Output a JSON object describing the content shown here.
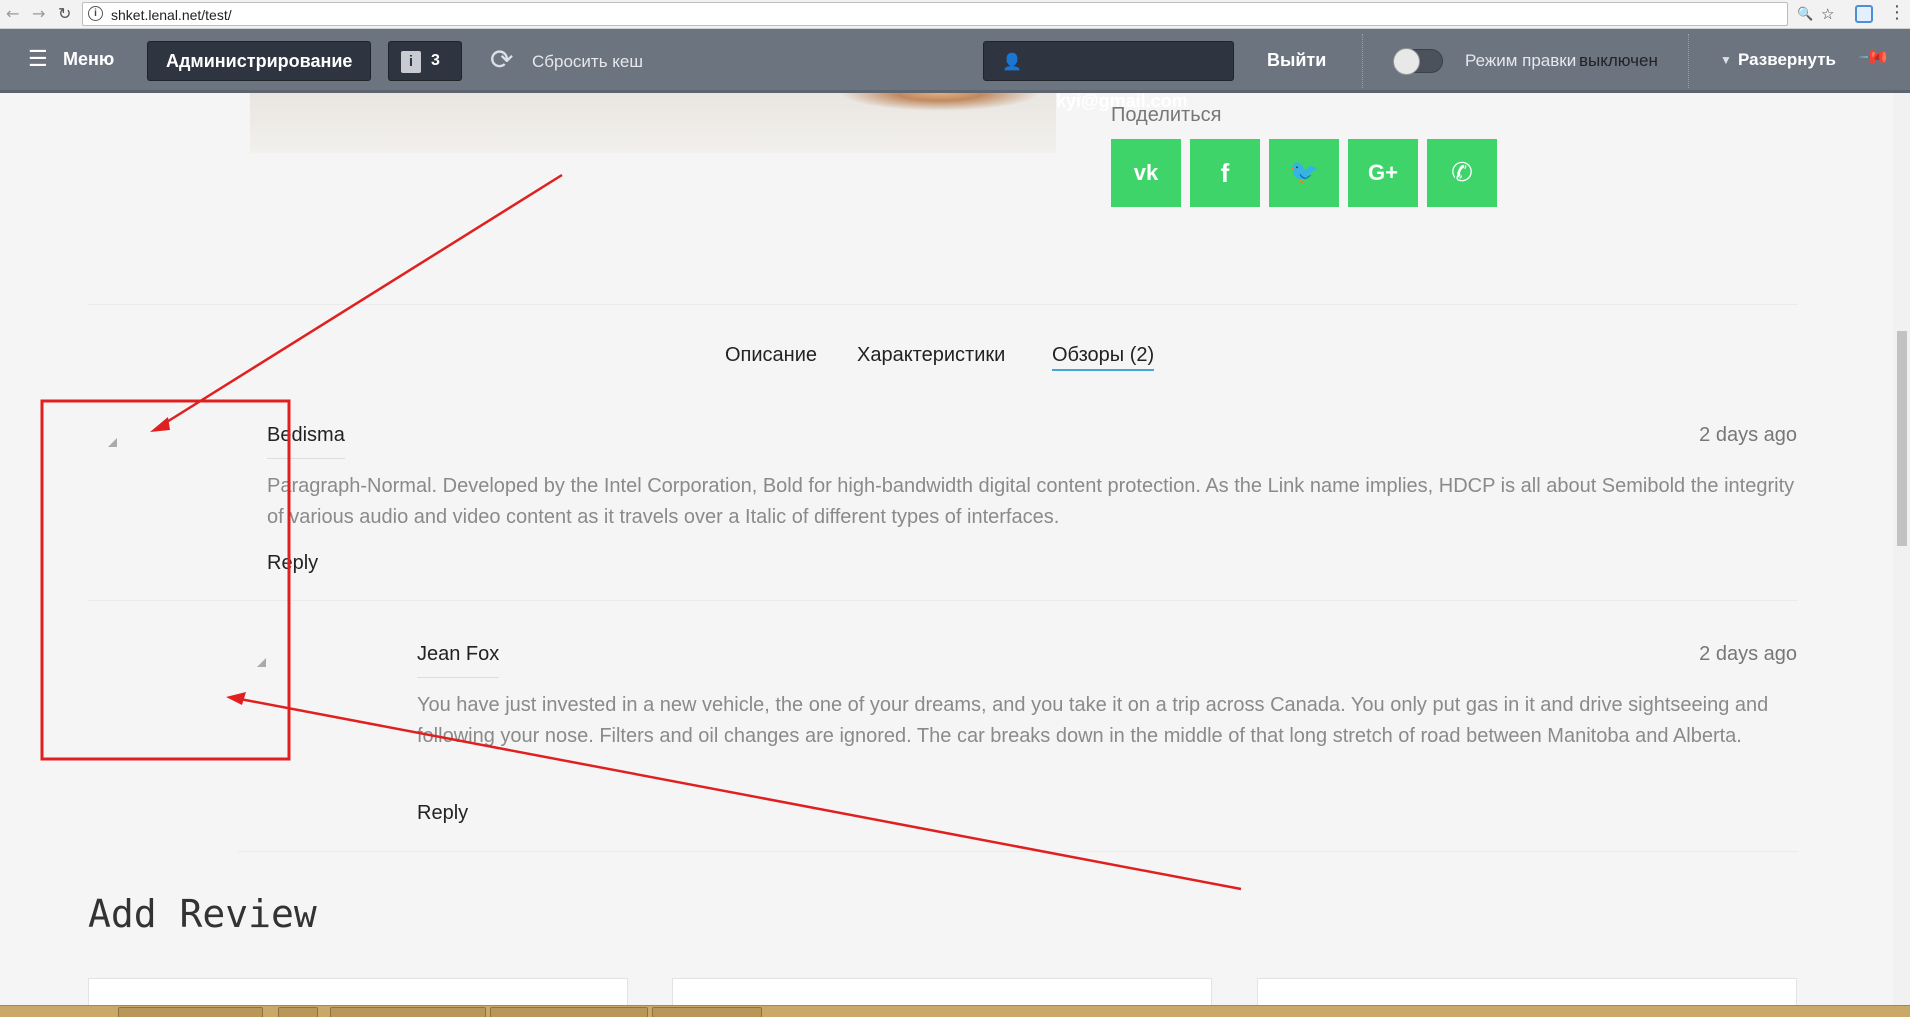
{
  "browser": {
    "url": "shket.lenal.net/test/",
    "back_icon": "←",
    "forward_icon": "→",
    "reload_icon": "↻",
    "info_icon": "i",
    "zoom_icon": "🔍",
    "star_icon": "☆",
    "menu_icon": "⋮"
  },
  "admin_panel": {
    "menu_icon": "☰",
    "menu_label": "Меню",
    "admin_label": "Администрирование",
    "notifications_count": "3",
    "reset_cache_label": "Сбросить кеш",
    "user_email": "koretskyi@gmail.com",
    "logout_label": "Выйти",
    "edit_mode_label": "Режим правки",
    "edit_mode_state": "выключен",
    "expand_label": "Развернуть"
  },
  "share": {
    "title": "Поделиться",
    "buttons": [
      {
        "name": "vk",
        "glyph": "vk"
      },
      {
        "name": "facebook",
        "glyph": "f"
      },
      {
        "name": "twitter",
        "glyph": "🐦"
      },
      {
        "name": "google-plus",
        "glyph": "G+"
      },
      {
        "name": "viber",
        "glyph": "✆"
      }
    ],
    "color": "#3fd46a"
  },
  "tabs": [
    {
      "label": "Описание",
      "active": false
    },
    {
      "label": "Характеристики",
      "active": false
    },
    {
      "label": "Обзоры (2)",
      "active": true
    }
  ],
  "reviews": [
    {
      "author": "Bedisma",
      "date": "2 days ago",
      "text": "Paragraph-Normal. Developed by the Intel Corporation, Bold for high-bandwidth digital content protection. As the Link name implies, HDCP is all about Semibold the integrity of various audio and video content as it travels over a Italic of different types of interfaces.",
      "reply_label": "Reply"
    },
    {
      "author": "Jean Fox",
      "date": "2 days ago",
      "text": "You have just invested in a new vehicle, the one of your dreams, and you take it on a trip across Canada. You only put gas in it and drive sightseeing and following your nose. Filters and oil changes are ignored. The car breaks down in the middle of that long stretch of road between Manitoba and Alberta.",
      "reply_label": "Reply"
    }
  ],
  "add_review": {
    "title": "Add Review"
  },
  "colors": {
    "accent": "#3fa9d6",
    "annotation": "#e02020",
    "admin_bar": "#6c7480"
  }
}
